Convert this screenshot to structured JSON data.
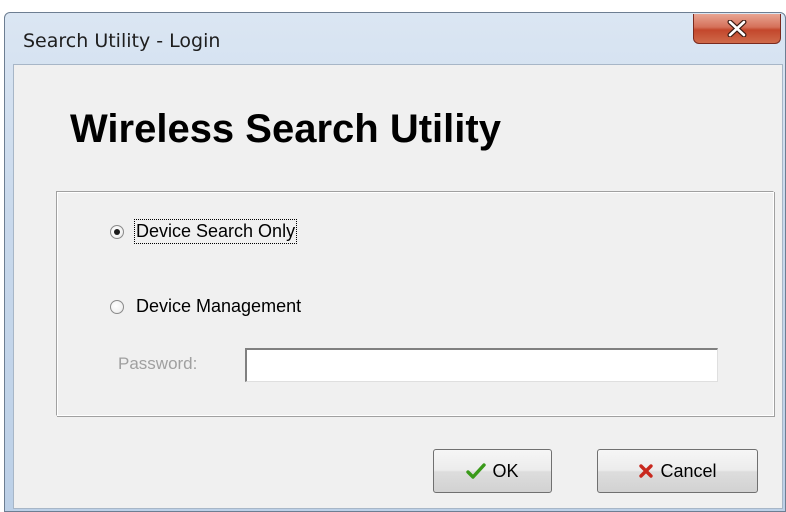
{
  "window": {
    "title": "Search Utility - Login"
  },
  "main": {
    "heading": "Wireless Search Utility"
  },
  "options": {
    "device_search_only": "Device Search Only",
    "device_management": "Device Management",
    "selected": "device_search_only"
  },
  "password": {
    "label": "Password:",
    "value": ""
  },
  "buttons": {
    "ok_label": "OK",
    "cancel_label": "Cancel"
  },
  "icons": {
    "close": "close-icon",
    "ok": "checkmark-icon",
    "cancel": "cross-icon"
  },
  "colors": {
    "close_button": "#c3472c",
    "ok_check": "#3a9a1a",
    "cancel_cross": "#c8281e",
    "disabled_text": "#a0a0a0"
  }
}
